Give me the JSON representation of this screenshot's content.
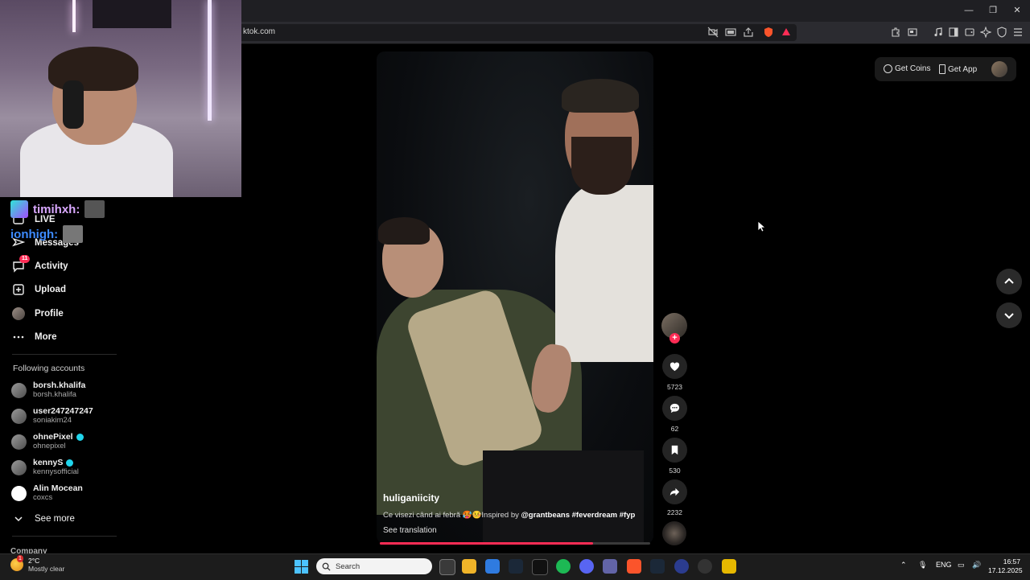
{
  "browser": {
    "url": "ktok.com",
    "window_buttons": [
      "—",
      "❐",
      "✕"
    ]
  },
  "header": {
    "get_coins": "Get Coins",
    "get_app": "Get App"
  },
  "sidebar": {
    "items": [
      {
        "label": "LIVE",
        "icon": "live-icon"
      },
      {
        "label": "Messages",
        "icon": "messages-icon"
      },
      {
        "label": "Activity",
        "icon": "activity-icon",
        "badge": "11"
      },
      {
        "label": "Upload",
        "icon": "upload-icon"
      },
      {
        "label": "Profile",
        "icon": "profile-icon"
      },
      {
        "label": "More",
        "icon": "more-icon"
      }
    ],
    "following_title": "Following accounts",
    "accounts": [
      {
        "name": "borsh.khalifa",
        "user": "borsh.khalifa",
        "verified": false
      },
      {
        "name": "user247247247",
        "user": "soniakim24",
        "verified": false
      },
      {
        "name": "ohnePixel",
        "user": "ohnepixel",
        "verified": true
      },
      {
        "name": "kennyS",
        "user": "kennysofficial",
        "verified": true
      },
      {
        "name": "Alin Mocean",
        "user": "coxcs",
        "verified": false
      }
    ],
    "see_more": "See more",
    "company": "Company"
  },
  "stream_chat": [
    {
      "user": "timihxh:",
      "color": "#d9a8ff"
    },
    {
      "user": "ionhigh:",
      "color": "#3d8bff"
    }
  ],
  "video": {
    "username": "huliganiicity",
    "caption_text": "Ce visezi când ai febră 🥵🤒Inspired by ",
    "caption_tags": "@grantbeans #feverdream #fyp",
    "see_translation": "See translation",
    "progress": 0.79
  },
  "actions": {
    "likes": "5723",
    "comments": "62",
    "saves": "530",
    "shares": "2232"
  },
  "taskbar": {
    "weather_temp": "2°C",
    "weather_cond": "Mostly clear",
    "weather_badge": "1",
    "search_placeholder": "Search",
    "lang": "ENG",
    "time": "16:57",
    "date": "17.12.2025"
  },
  "colors": {
    "accent": "#fe2c55",
    "verified": "#20d5ec",
    "page_bg": "#000000"
  }
}
